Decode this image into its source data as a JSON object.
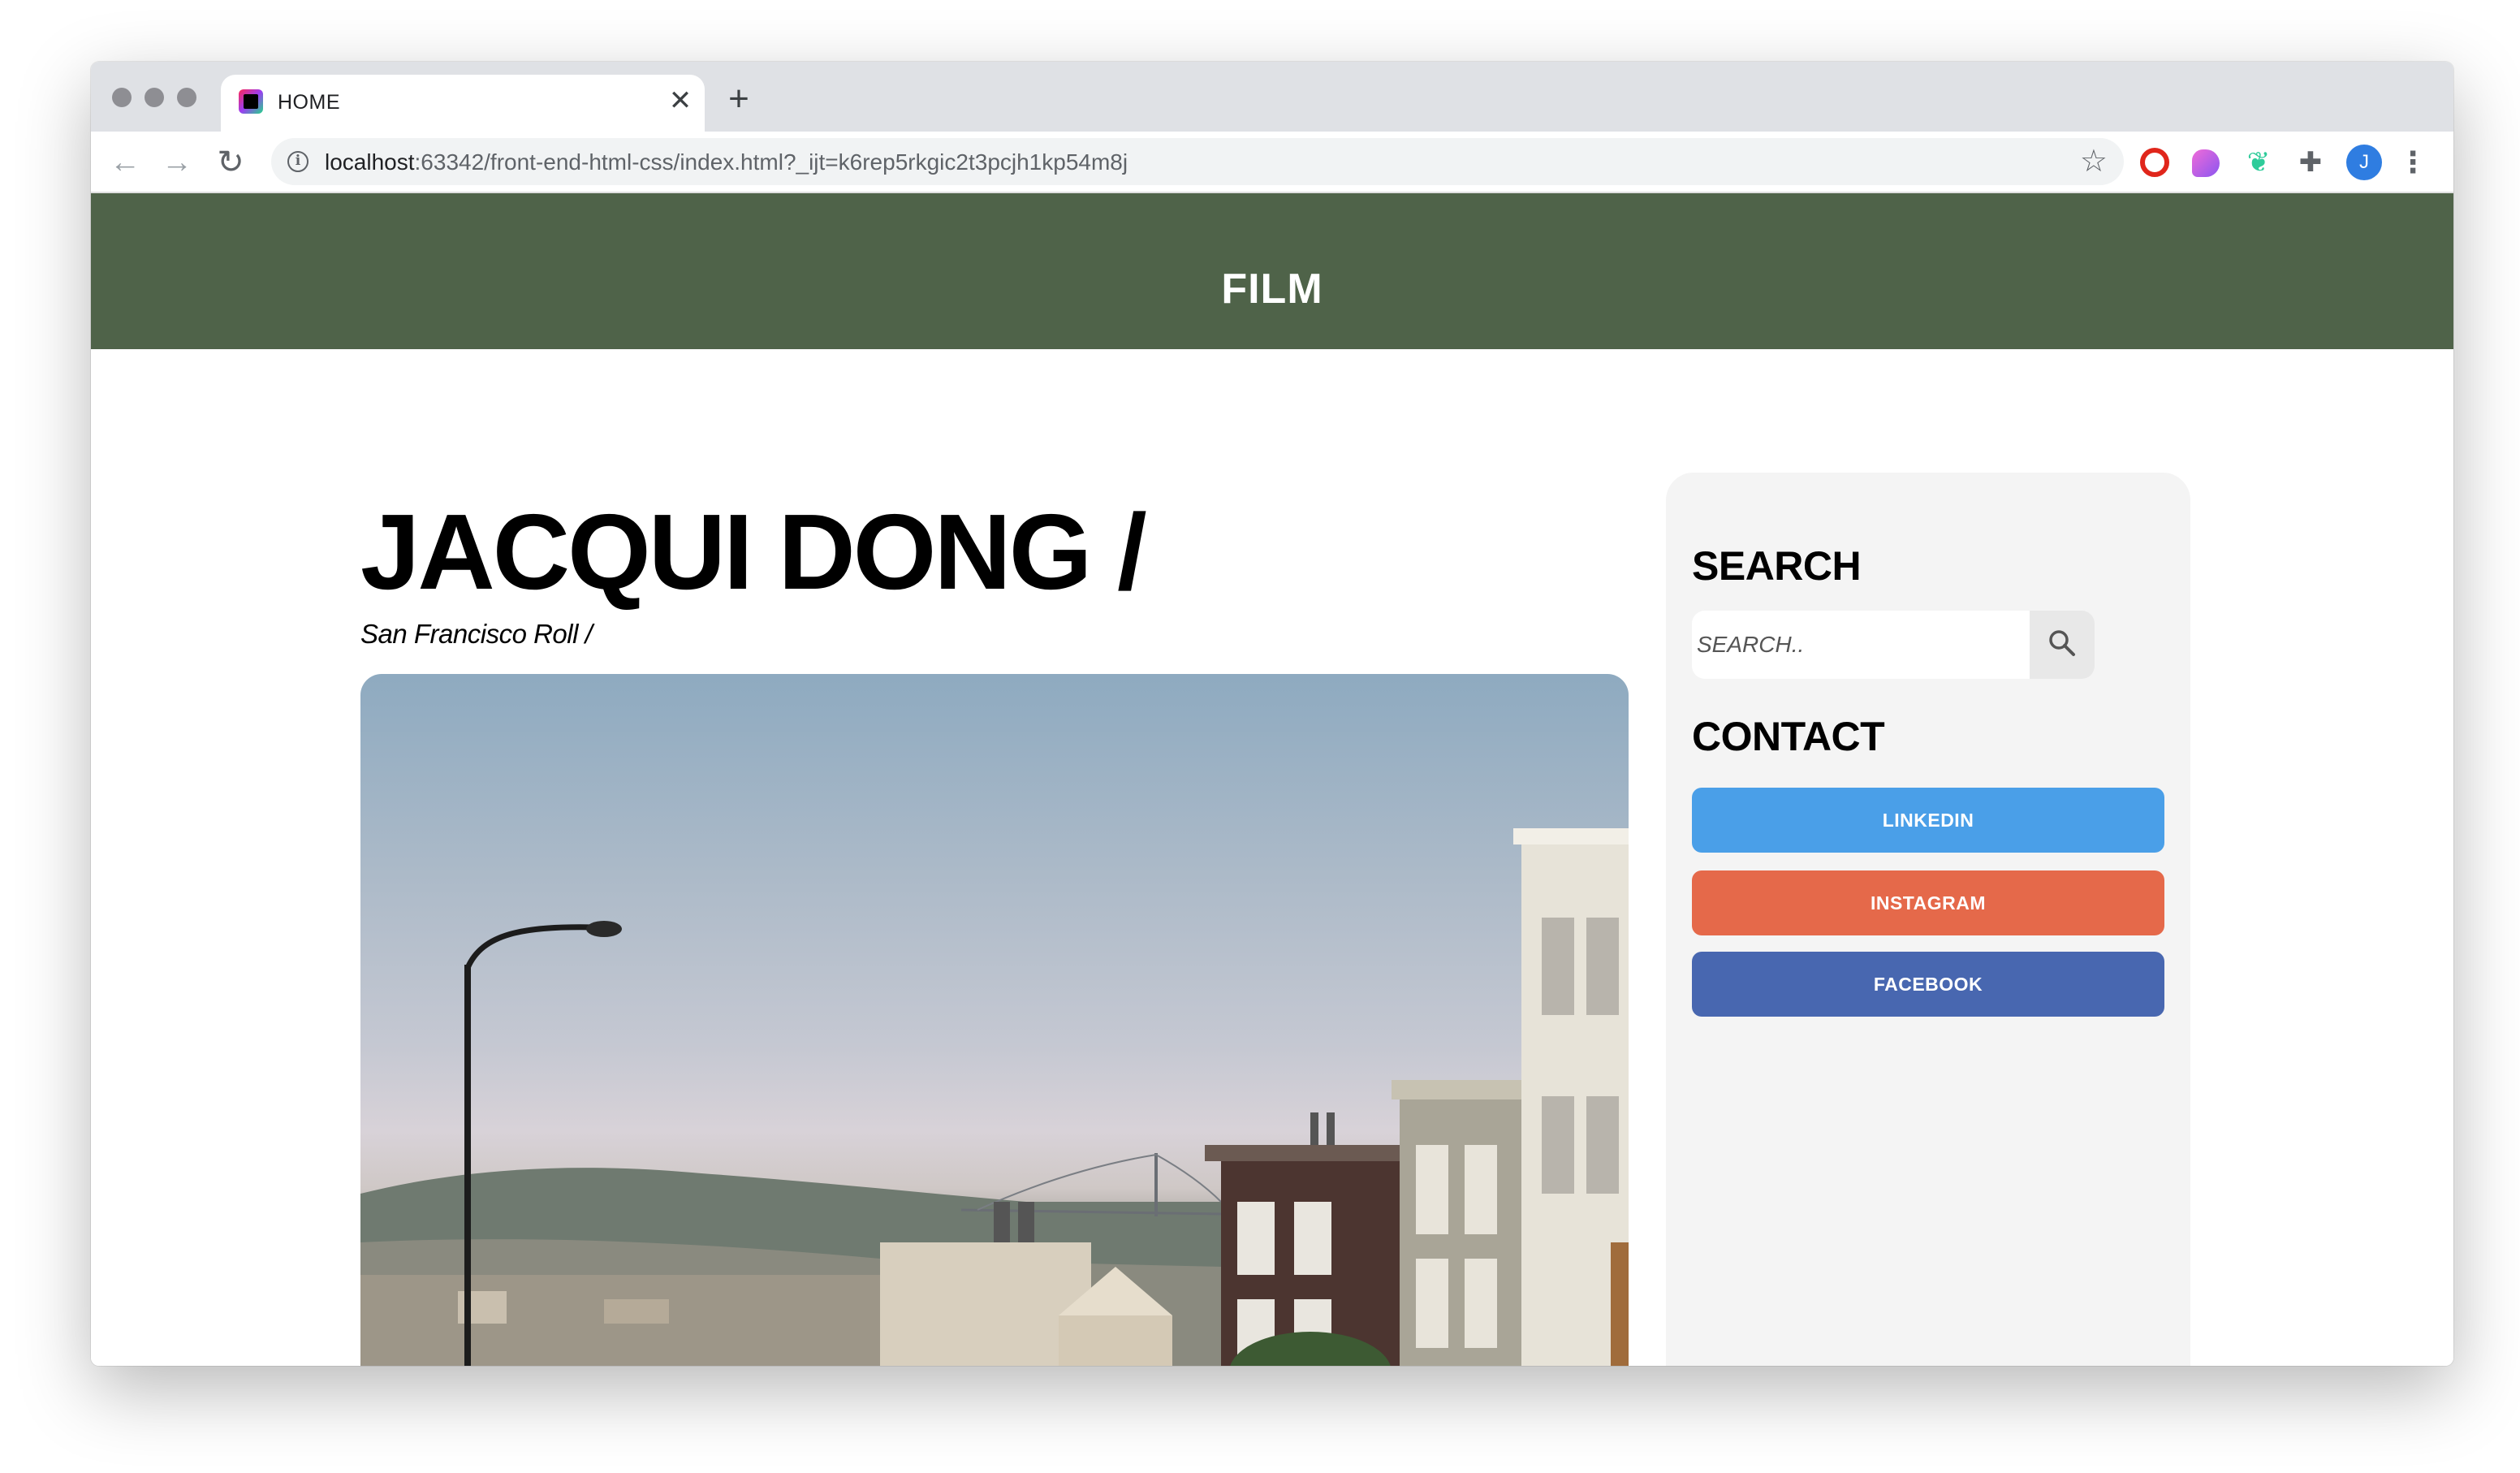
{
  "browser": {
    "tab_title": "HOME",
    "tab_close": "✕",
    "new_tab": "+",
    "url_host": "localhost",
    "url_rest": ":63342/front-end-html-css/index.html?_ijt=k6rep5rkgic2t3pcjh1kp54m8j",
    "avatar_initial": "J"
  },
  "site": {
    "header_title": "FILM",
    "header_color": "#4f6349"
  },
  "post": {
    "title": "JACQUI DONG /",
    "subtitle": "San Francisco Roll /"
  },
  "sidebar": {
    "search_heading": "SEARCH",
    "search_placeholder": "SEARCH..",
    "contact_heading": "CONTACT",
    "links": [
      {
        "label": "LINKEDIN",
        "color": "#4a9fe8"
      },
      {
        "label": "INSTAGRAM",
        "color": "#e5694a"
      },
      {
        "label": "FACEBOOK",
        "color": "#4867b0"
      }
    ]
  },
  "icons": {
    "back": "arrow-left-icon",
    "forward": "arrow-right-icon",
    "reload": "reload-icon",
    "info": "info-icon",
    "bookmark": "star-icon",
    "search": "magnifier-icon"
  }
}
